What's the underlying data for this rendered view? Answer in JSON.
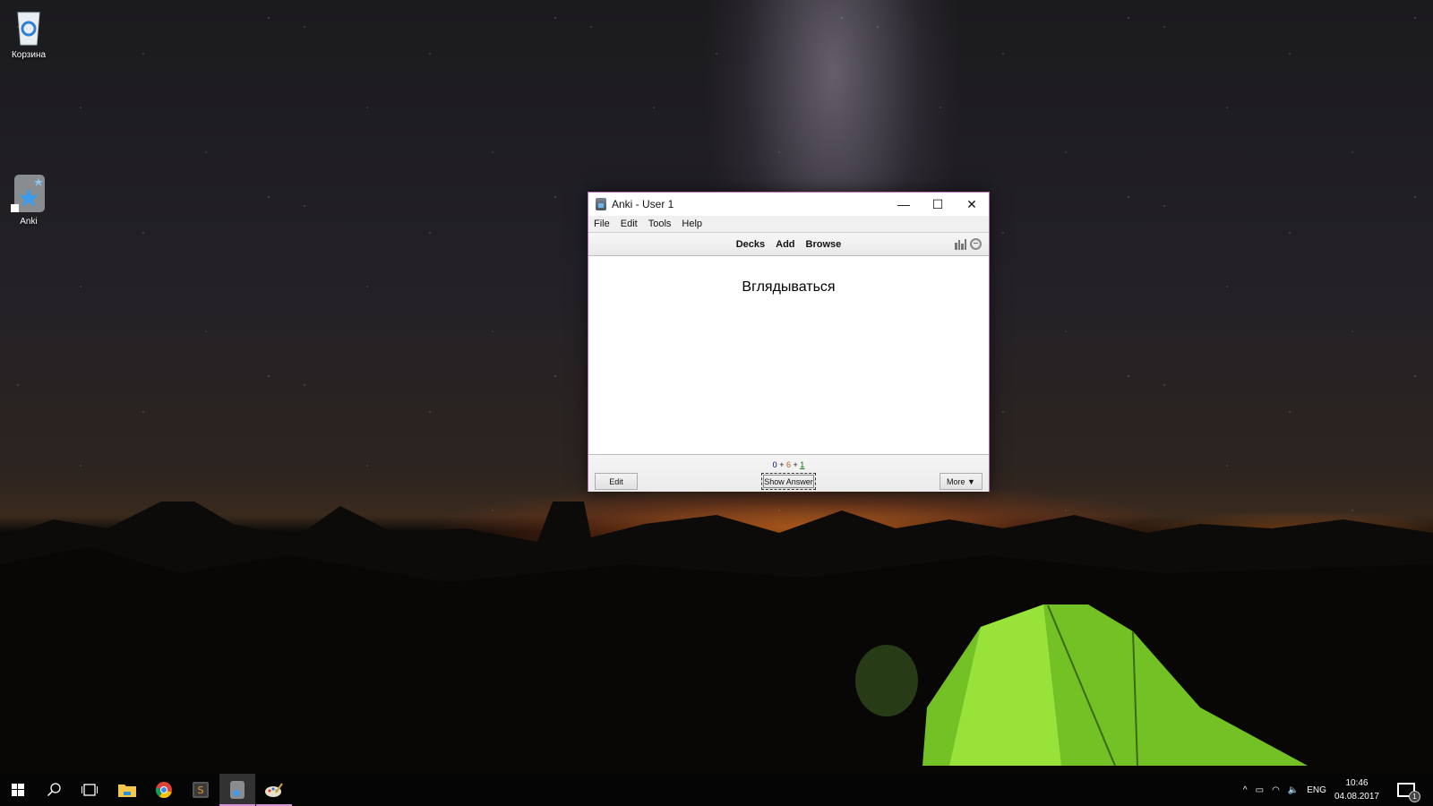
{
  "desktop": {
    "icons": [
      {
        "label": "Корзина",
        "icon": "recycle-bin-icon"
      },
      {
        "label": "Anki",
        "icon": "anki-icon"
      }
    ]
  },
  "window": {
    "title": "Anki - User 1",
    "border_color": "#b36ab4",
    "controls": {
      "minimize": "—",
      "maximize": "☐",
      "close": "✕"
    },
    "menu": [
      "File",
      "Edit",
      "Tools",
      "Help"
    ],
    "toolbar": {
      "links": [
        "Decks",
        "Add",
        "Browse"
      ],
      "icons": [
        "stats-icon",
        "sync-icon"
      ]
    },
    "card": {
      "question": "Вглядываться"
    },
    "footer": {
      "counts": {
        "new": "0",
        "learning": "6",
        "review": "1",
        "plus": "+"
      },
      "count_colors": {
        "new": "#000088",
        "learning": "#c35617",
        "review": "#007700"
      },
      "edit_label": "Edit",
      "show_answer_label": "Show Answer",
      "more_label": "More ▼"
    }
  },
  "taskbar": {
    "items": [
      "start-icon",
      "search-icon",
      "task-view-icon",
      "file-explorer-icon",
      "chrome-icon",
      "sublime-text-icon",
      "anki-icon",
      "paint-icon"
    ],
    "active_item": "anki-icon",
    "tray": {
      "chevron": "^",
      "language": "ENG",
      "time": "10:46",
      "date": "04.08.2017",
      "notification_count": "1"
    }
  }
}
